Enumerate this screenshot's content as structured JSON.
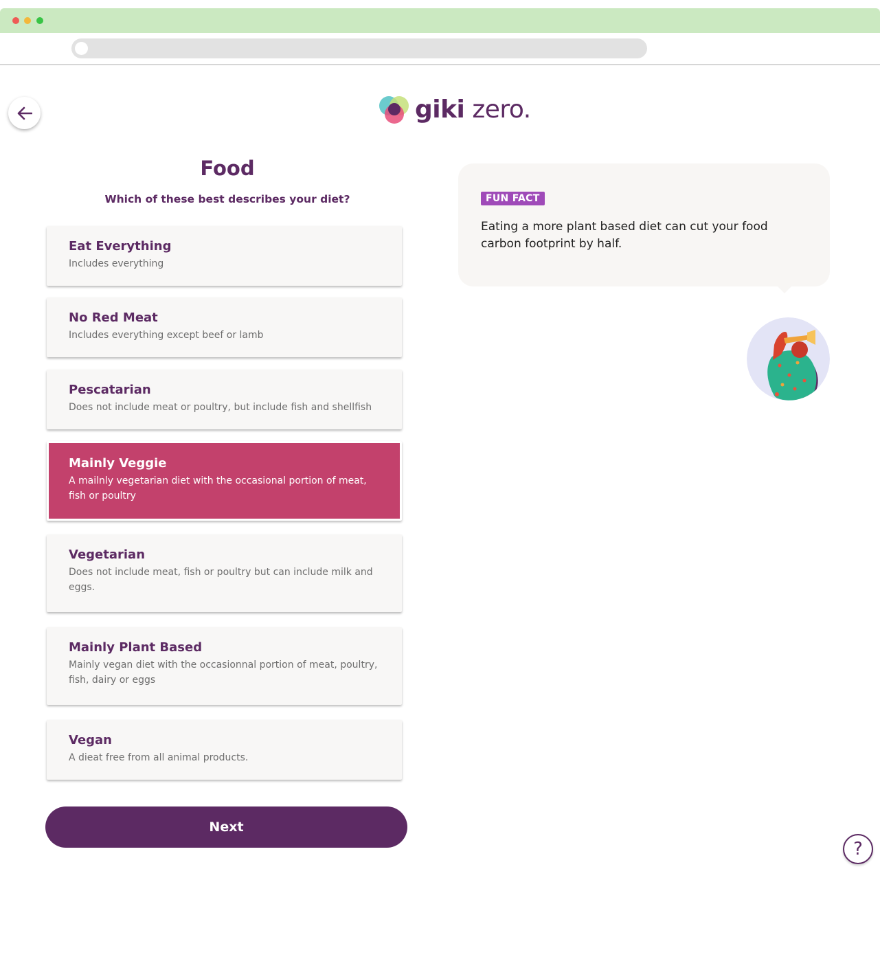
{
  "header": {
    "back_icon": "arrow-left-icon",
    "logo": {
      "brand_bold": "giki",
      "brand_light": " zero."
    }
  },
  "main": {
    "title": "Food",
    "question": "Which of these best describes your diet?",
    "options": [
      {
        "title": "Eat Everything",
        "description": "Includes everything",
        "selected": false
      },
      {
        "title": "No Red Meat",
        "description": "Includes everything except beef or lamb",
        "selected": false
      },
      {
        "title": "Pescatarian",
        "description": "Does not include meat or poultry, but include fish and shellfish",
        "selected": false
      },
      {
        "title": "Mainly Veggie",
        "description": "A mailnly vegetarian diet with the occasional portion of meat, fish or poultry",
        "selected": true
      },
      {
        "title": "Vegetarian",
        "description": "Does not include meat, fish or poultry but can include milk and eggs.",
        "selected": false
      },
      {
        "title": "Mainly Plant Based",
        "description": "Mainly vegan diet with the occasionnal portion of meat, poultry, fish, dairy or eggs",
        "selected": false
      },
      {
        "title": "Vegan",
        "description": "A dieat free from all animal products.",
        "selected": false
      }
    ],
    "next_label": "Next"
  },
  "fun_fact": {
    "badge": "FUN FACT",
    "text": "Eating a more plant based diet can cut your food carbon footprint by half."
  },
  "help": {
    "label": "?",
    "icon": "help-icon"
  },
  "colors": {
    "primary": "#5c2a63",
    "selected": "#c3416c",
    "badge": "#9f4ab8",
    "titlebar": "#cbe9c1"
  }
}
